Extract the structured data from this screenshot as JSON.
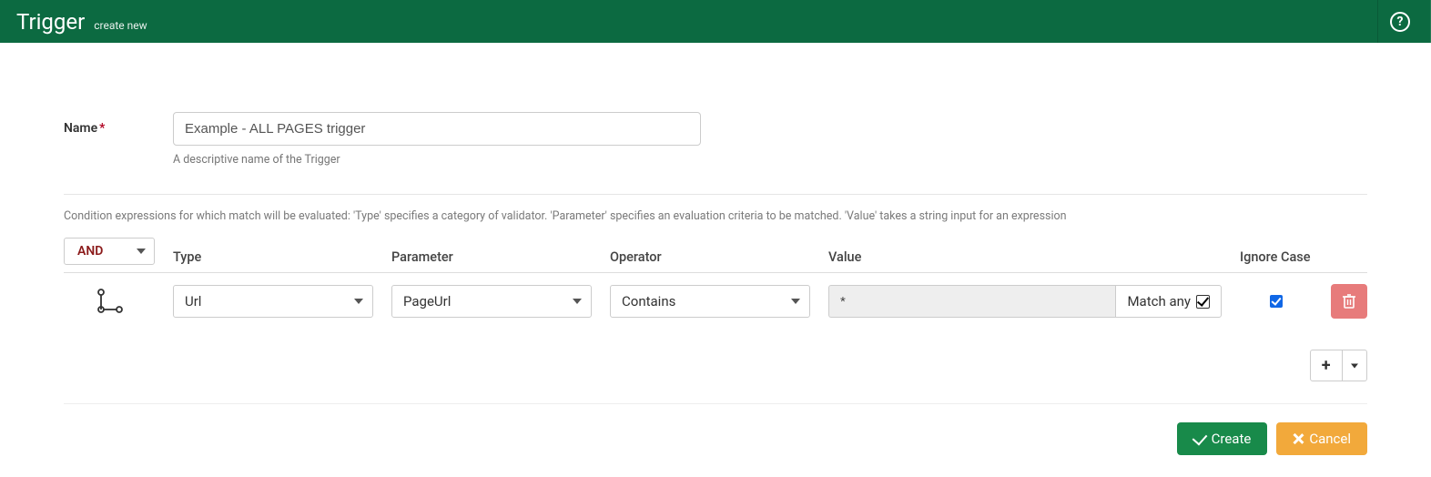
{
  "header": {
    "title": "Trigger",
    "subtitle": "create new"
  },
  "form": {
    "name_label": "Name",
    "name_value": "Example - ALL PAGES trigger",
    "name_help": "A descriptive name of the Trigger"
  },
  "conditions": {
    "intro": "Condition expressions for which match will be evaluated: 'Type' specifies a category of validator. 'Parameter' specifies an evaluation criteria to be matched. 'Value' takes a string input for an expression",
    "logic": "AND",
    "columns": {
      "type": "Type",
      "parameter": "Parameter",
      "operator": "Operator",
      "value": "Value",
      "ignore_case": "Ignore Case"
    },
    "rows": [
      {
        "type": "Url",
        "parameter": "PageUrl",
        "operator": "Contains",
        "value": "*",
        "match_any_label": "Match any",
        "match_any": true,
        "ignore_case": true
      }
    ]
  },
  "actions": {
    "create": "Create",
    "cancel": "Cancel"
  }
}
